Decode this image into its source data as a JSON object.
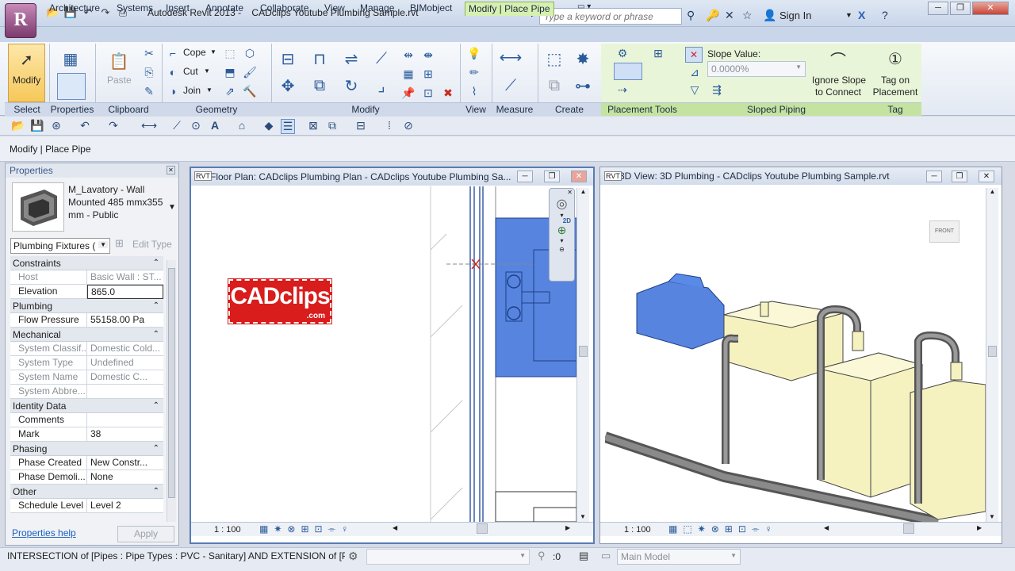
{
  "app": {
    "title": "Autodesk Revit 2013 -",
    "file": "CADclips Youtube Plumbing Sample.rvt",
    "app_letter": "R"
  },
  "search": {
    "placeholder": "Type a keyword or phrase"
  },
  "account": {
    "sign_in": "Sign In"
  },
  "tabs": [
    "Architecture",
    "Systems",
    "Insert",
    "Annotate",
    "Collaborate",
    "View",
    "Manage",
    "BIMobject",
    "Modify | Place Pipe"
  ],
  "ribbon": {
    "modify": "Modify",
    "properties": "Properties",
    "paste": "Paste",
    "cope": "Cope",
    "cut": "Cut",
    "join": "Join",
    "slope_value_label": "Slope Value:",
    "slope_value": "0.0000%",
    "ignore_slope_l1": "Ignore Slope",
    "ignore_slope_l2": "to Connect",
    "tag_l1": "Tag on",
    "tag_l2": "Placement",
    "panels": {
      "select": "Select",
      "properties": "Properties",
      "clipboard": "Clipboard",
      "geometry": "Geometry",
      "modify": "Modify",
      "view": "View",
      "measure": "Measure",
      "create": "Create",
      "placement_tools": "Placement Tools",
      "sloped_piping": "Sloped Piping",
      "tag": "Tag"
    }
  },
  "context": {
    "label": "Modify | Place Pipe"
  },
  "properties": {
    "header": "Properties",
    "type_name": "M_Lavatory - Wall Mounted 485 mmx355 mm - Public",
    "category": "Plumbing Fixtures (",
    "edit_type": "Edit Type",
    "help": "Properties help",
    "apply": "Apply",
    "sections": {
      "constraints": "Constraints",
      "plumbing": "Plumbing",
      "mechanical": "Mechanical",
      "identity": "Identity Data",
      "phasing": "Phasing",
      "other": "Other"
    },
    "rows": {
      "host_k": "Host",
      "host_v": "Basic Wall : ST...",
      "elev_k": "Elevation",
      "elev_v": "865.0",
      "flow_k": "Flow Pressure",
      "flow_v": "55158.00 Pa",
      "sysclass_k": "System Classif...",
      "sysclass_v": "Domestic Cold...",
      "systype_k": "System Type",
      "systype_v": "Undefined",
      "sysname_k": "System Name",
      "sysname_v": "Domestic C...",
      "sysabbr_k": "System Abbre...",
      "sysabbr_v": "",
      "comments_k": "Comments",
      "comments_v": "",
      "mark_k": "Mark",
      "mark_v": "38",
      "phasecr_k": "Phase Created",
      "phasecr_v": "New Constr...",
      "phasedem_k": "Phase Demoli...",
      "phasedem_v": "None",
      "sched_k": "Schedule Level",
      "sched_v": "Level 2"
    }
  },
  "floor_view": {
    "title": "Floor Plan: CADclips Plumbing Plan - CADclips Youtube Plumbing Sa...",
    "scale": "1 : 100",
    "logo_main": "CADclips",
    "logo_sub": ".com",
    "nav_2d": "2D"
  },
  "view3d": {
    "title": "3D View: 3D Plumbing - CADclips Youtube Plumbing Sample.rvt",
    "scale": "1 : 100",
    "cube_label": "FRONT"
  },
  "status": {
    "text": "INTERSECTION  of [Pipes : Pipe Types : PVC - Sanitary] AND EXTENSION  of [Plur",
    "count": ":0",
    "model": "Main Model"
  },
  "colors": {
    "accent_green": "#d6f0b0",
    "selection_blue": "#3a6fd8",
    "logo_red": "#d91c1c"
  }
}
